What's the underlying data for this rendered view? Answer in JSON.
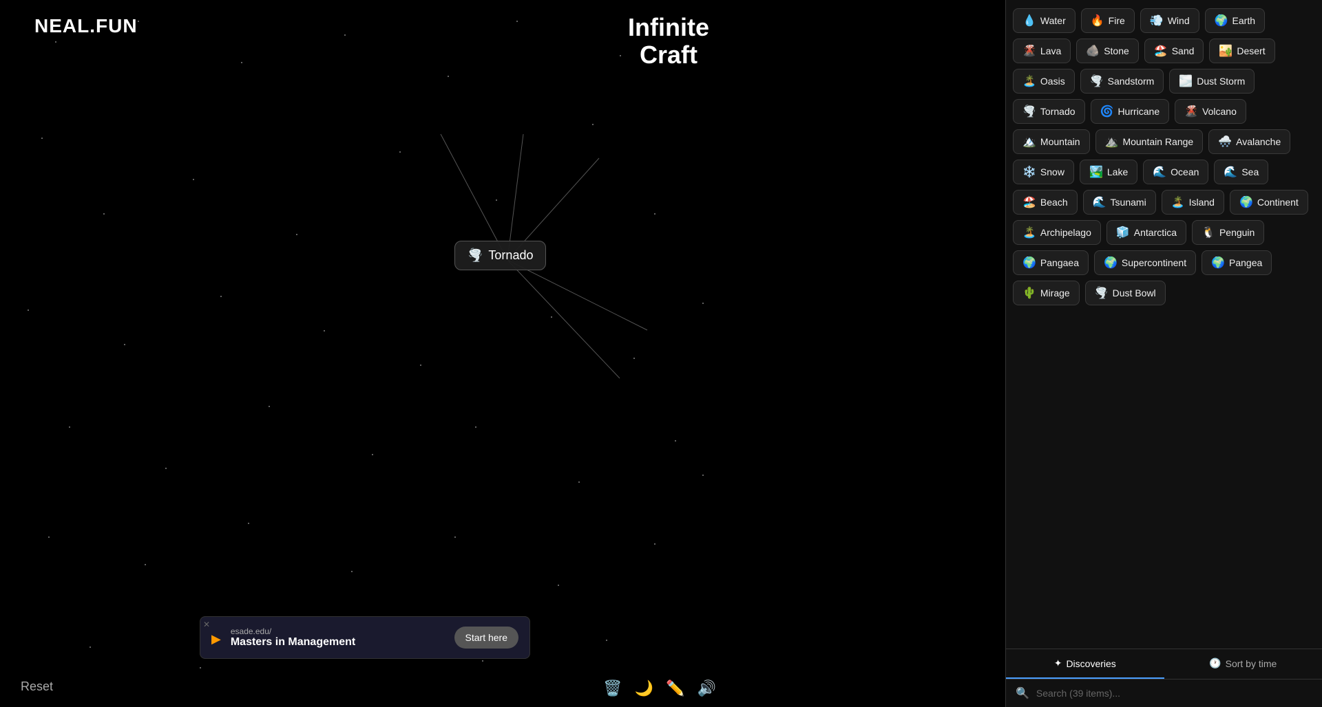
{
  "logo": "NEAL.FUN",
  "gameTitle": {
    "line1": "Infinite",
    "line2": "Craft"
  },
  "canvas": {
    "tornadoLabel": "Tornado",
    "tornadoEmoji": "🌪️"
  },
  "bottomBar": {
    "resetLabel": "Reset",
    "icons": [
      "🗑️",
      "🌙",
      "✏️",
      "🔊"
    ]
  },
  "ad": {
    "closeLabel": "✕",
    "url": "esade.edu/",
    "title": "Masters in Management",
    "cta": "Start here"
  },
  "sidebar": {
    "items": [
      {
        "emoji": "💧",
        "label": "Water"
      },
      {
        "emoji": "🔥",
        "label": "Fire"
      },
      {
        "emoji": "💨",
        "label": "Wind"
      },
      {
        "emoji": "🌍",
        "label": "Earth"
      },
      {
        "emoji": "🌋",
        "label": "Lava"
      },
      {
        "emoji": "🪨",
        "label": "Stone"
      },
      {
        "emoji": "🏖️",
        "label": "Sand"
      },
      {
        "emoji": "🏜️",
        "label": "Desert"
      },
      {
        "emoji": "🏝️",
        "label": "Oasis"
      },
      {
        "emoji": "🌪️",
        "label": "Sandstorm"
      },
      {
        "emoji": "🌫️",
        "label": "Dust Storm"
      },
      {
        "emoji": "🌪️",
        "label": "Tornado"
      },
      {
        "emoji": "🌀",
        "label": "Hurricane"
      },
      {
        "emoji": "🌋",
        "label": "Volcano"
      },
      {
        "emoji": "🏔️",
        "label": "Mountain"
      },
      {
        "emoji": "⛰️",
        "label": "Mountain Range"
      },
      {
        "emoji": "🌨️",
        "label": "Avalanche"
      },
      {
        "emoji": "❄️",
        "label": "Snow"
      },
      {
        "emoji": "🏞️",
        "label": "Lake"
      },
      {
        "emoji": "🌊",
        "label": "Ocean"
      },
      {
        "emoji": "🌊",
        "label": "Sea"
      },
      {
        "emoji": "🏖️",
        "label": "Beach"
      },
      {
        "emoji": "🌊",
        "label": "Tsunami"
      },
      {
        "emoji": "🏝️",
        "label": "Island"
      },
      {
        "emoji": "🌍",
        "label": "Continent"
      },
      {
        "emoji": "🏝️",
        "label": "Archipelago"
      },
      {
        "emoji": "🧊",
        "label": "Antarctica"
      },
      {
        "emoji": "🐧",
        "label": "Penguin"
      },
      {
        "emoji": "🌍",
        "label": "Pangaea"
      },
      {
        "emoji": "🌍",
        "label": "Supercontinent"
      },
      {
        "emoji": "🌍",
        "label": "Pangea"
      },
      {
        "emoji": "🌵",
        "label": "Mirage"
      },
      {
        "emoji": "🌪️",
        "label": "Dust Bowl"
      }
    ],
    "footer": {
      "discoveriesTab": "Discoveries",
      "sortByTimeTab": "Sort by time",
      "searchPlaceholder": "Search (39 items)..."
    }
  }
}
